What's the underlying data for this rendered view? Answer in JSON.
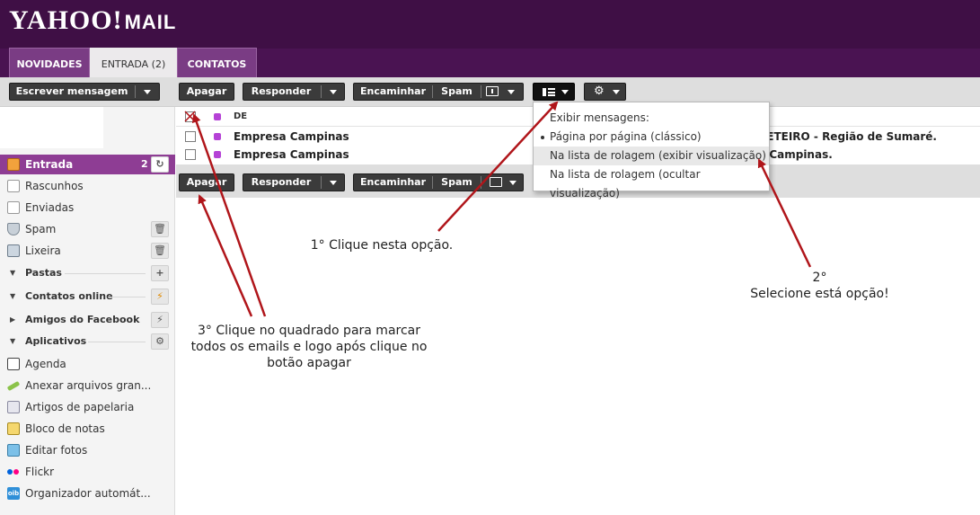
{
  "header": {
    "logo": "YAHOO!",
    "logo_mail": "MAIL"
  },
  "tabs": [
    {
      "label": "NOVIDADES"
    },
    {
      "label": "ENTRADA (2)"
    },
    {
      "label": "CONTATOS"
    }
  ],
  "toolbar": {
    "compose": "Escrever mensagem",
    "delete": "Apagar",
    "reply": "Responder",
    "forward": "Encaminhar",
    "spam": "Spam"
  },
  "sidebar": {
    "inbox": {
      "label": "Entrada",
      "count": "2"
    },
    "folders": [
      "Rascunhos",
      "Enviadas",
      "Spam",
      "Lixeira"
    ],
    "sections": [
      "Pastas",
      "Contatos online",
      "Amigos do Facebook",
      "Aplicativos"
    ],
    "apps": [
      "Agenda",
      "Anexar arquivos gran...",
      "Artigos de papelaria",
      "Bloco de notas",
      "Editar fotos",
      "Flickr",
      "Organizador automát..."
    ]
  },
  "list": {
    "column_from": "DE",
    "rows": [
      {
        "from": "Empresa Campinas",
        "subject": "RETEIRO - Região de Sumaré."
      },
      {
        "from": "Empresa Campinas",
        "subject": "e Campinas."
      }
    ]
  },
  "menu": {
    "title": "Exibir mensagens:",
    "options": [
      "Página por página (clássico)",
      "Na lista de rolagem (exibir visualização)",
      "Na lista de rolagem (ocultar visualização)"
    ]
  },
  "annotations": {
    "step1": "1° Clique nesta opção.",
    "step2_num": "2°",
    "step2_text": "Selecione está opção!",
    "step3": [
      "3° Clique no quadrado para marcar",
      "todos os emails e logo após clique no",
      "botão apagar"
    ]
  },
  "colors": {
    "header": "#4a1352",
    "accent": "#8e3d94",
    "arrow": "#b0151a",
    "button": "#3b3b3b",
    "unread_dot": "#b542d6"
  }
}
